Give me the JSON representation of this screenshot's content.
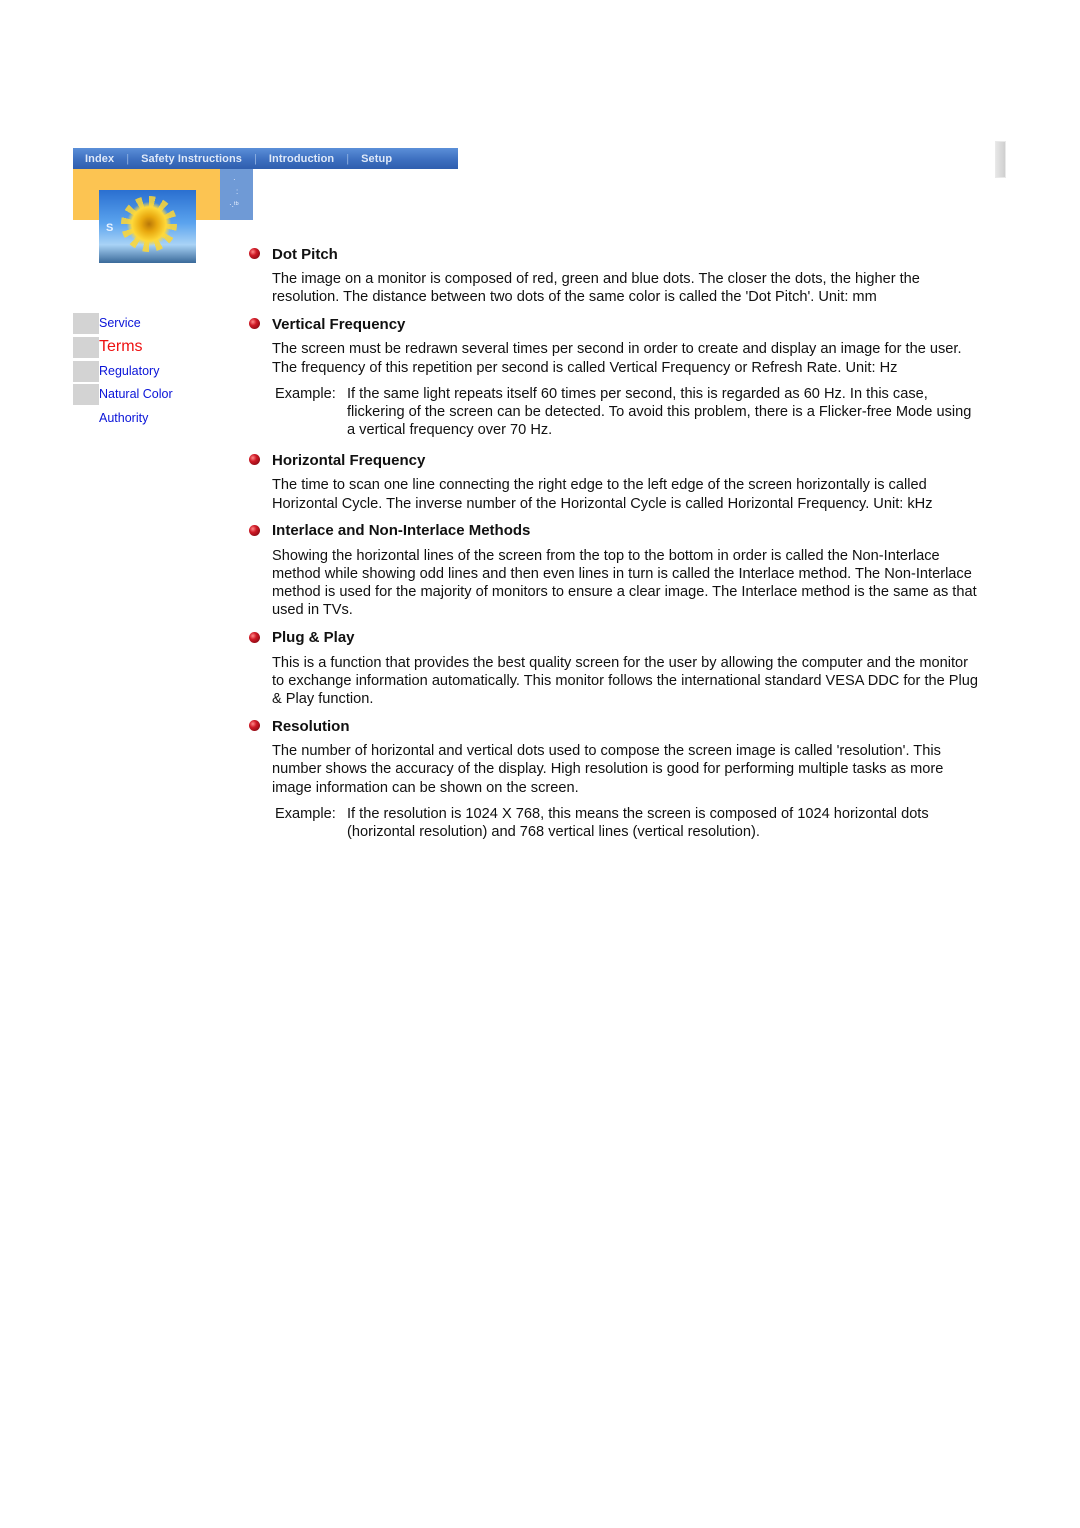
{
  "topnav": {
    "tabs": [
      "Index",
      "Safety Instructions",
      "Introduction",
      "Setup"
    ]
  },
  "header": {
    "photo_letter": "S",
    "colors": {
      "nav_blue": "#3d6fc0",
      "orange": "#fcc452",
      "side_blue": "#6f9ad6"
    }
  },
  "sidebar": {
    "items": [
      {
        "label": "Service",
        "active": false
      },
      {
        "label": "Terms",
        "active": true
      },
      {
        "label": "Regulatory",
        "active": false
      },
      {
        "label": "Natural Color",
        "active": false
      },
      {
        "label": "Authority",
        "active": false
      }
    ],
    "colors": {
      "link": "#0a14d8",
      "active": "#ee1111"
    }
  },
  "sections": [
    {
      "title": "Dot Pitch",
      "body": "The image on a monitor is composed of red, green and blue dots. The closer the dots, the higher the resolution. The distance between two dots of the same color is called the 'Dot Pitch'. Unit: mm"
    },
    {
      "title": "Vertical Frequency",
      "body": "The screen must be redrawn several times per second in order to create and display an image for the user. The frequency of this repetition per second is called Vertical Frequency or Refresh Rate. Unit: Hz",
      "example_label": "Example:",
      "example": "If the same light repeats itself 60 times per second, this is regarded as 60 Hz. In this case, flickering of the screen can be detected. To avoid this problem, there is a Flicker-free Mode using a vertical frequency over 70 Hz."
    },
    {
      "title": "Horizontal Frequency",
      "body": "The time to scan one line connecting the right edge to the left edge of the screen horizontally is called Horizontal Cycle. The inverse number of the Horizontal Cycle is called Horizontal Frequency. Unit: kHz"
    },
    {
      "title": "Interlace and Non-Interlace Methods",
      "body": "Showing the horizontal lines of the screen from the top to the bottom in order is called the Non-Interlace method while showing odd lines and then even lines in turn is called the Interlace method. The Non-Interlace method is used for the majority of monitors to ensure a clear image. The Interlace method is the same as that used in TVs."
    },
    {
      "title": "Plug & Play",
      "body": "This is a function that provides the best quality screen for the user by allowing the computer and the monitor to exchange information automatically. This monitor follows the international standard VESA DDC for the Plug & Play function."
    },
    {
      "title": "Resolution",
      "body": "The number of horizontal and vertical dots used to compose the screen image is called 'resolution'. This number shows the accuracy of the display. High resolution is good for performing multiple tasks as more image information can be shown on the screen.",
      "example_label": "Example:",
      "example": "If the resolution is 1024 X 768, this means the screen is composed of 1024 horizontal dots (horizontal resolution) and 768 vertical lines (vertical resolution)."
    }
  ]
}
